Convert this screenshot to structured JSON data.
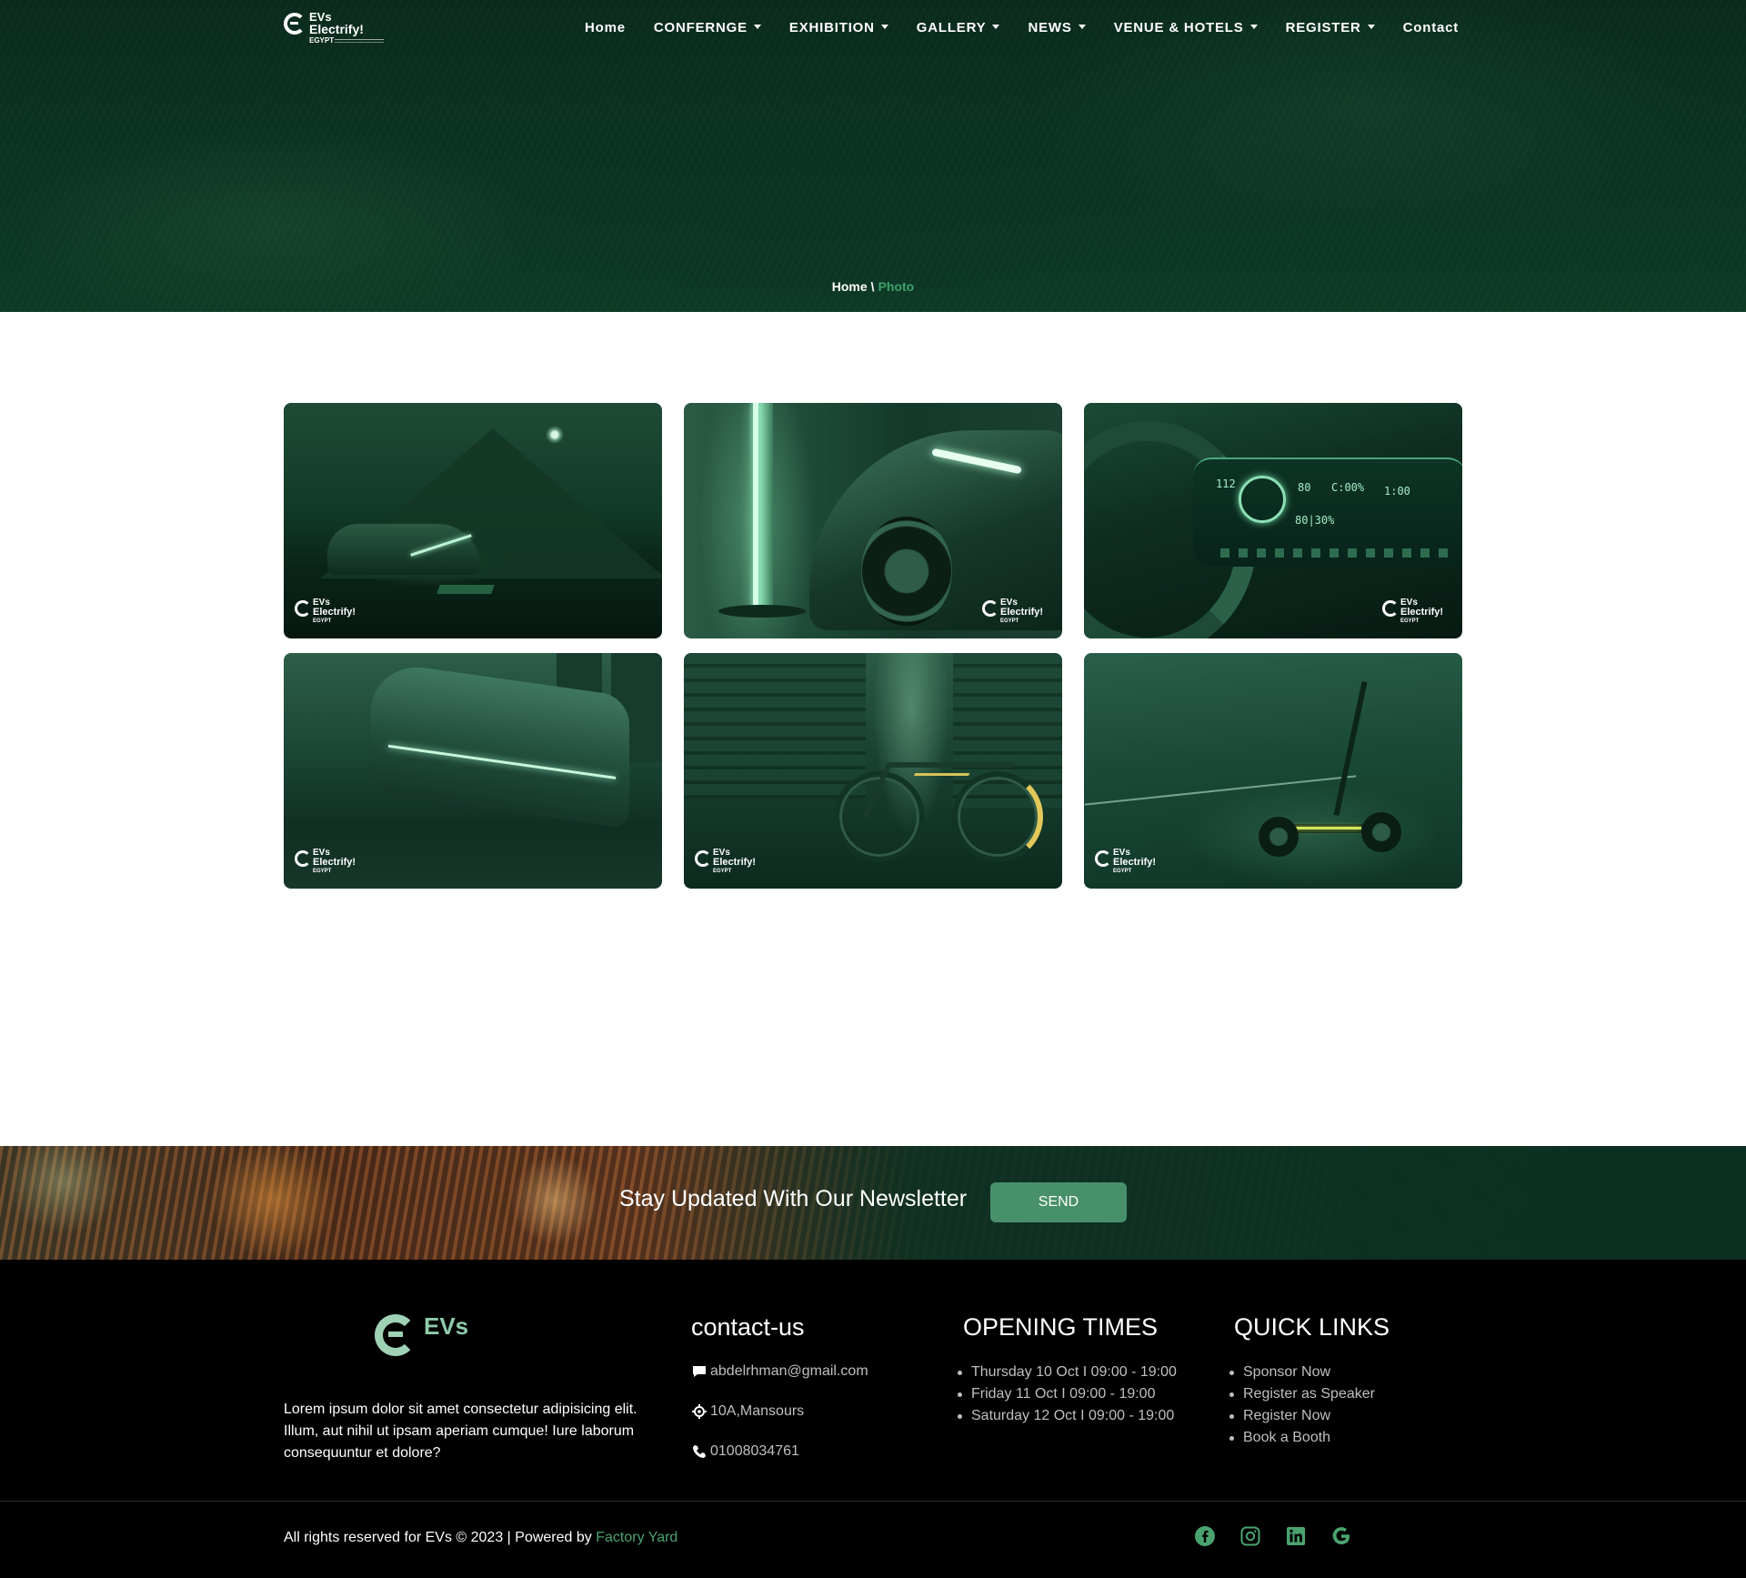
{
  "brand": {
    "logo_line1": "EVs",
    "logo_line2": "Electrify!",
    "logo_line3": "EGYPT",
    "watermark_line1": "EVs",
    "watermark_line2": "Electrify!",
    "watermark_line3": "EGYPT",
    "footer_logo_text": "EVs"
  },
  "nav": {
    "items": [
      {
        "label": "Home",
        "dropdown": false
      },
      {
        "label": "CONFERNGE",
        "dropdown": true
      },
      {
        "label": "EXHIBITION",
        "dropdown": true
      },
      {
        "label": "GALLERY",
        "dropdown": true
      },
      {
        "label": "NEWS",
        "dropdown": true
      },
      {
        "label": "VENUE & HOTELS",
        "dropdown": true
      },
      {
        "label": "REGISTER",
        "dropdown": true
      },
      {
        "label": "Contact",
        "dropdown": false
      }
    ]
  },
  "breadcrumb": {
    "home": "Home",
    "separator": "\\",
    "current": "Photo"
  },
  "gallery": {
    "photos": [
      {
        "subject": "electric car by pyramid"
      },
      {
        "subject": "electric car at charging station"
      },
      {
        "subject": "ev dashboard",
        "readouts": [
          "112",
          "80",
          "C:00%",
          "1:00",
          "80|30%"
        ]
      },
      {
        "subject": "electric bus"
      },
      {
        "subject": "electric bicycle"
      },
      {
        "subject": "electric scooter"
      }
    ]
  },
  "newsletter": {
    "title": "Stay Updated With Our Newsletter",
    "button_label": "SEND"
  },
  "footer": {
    "about": "Lorem ipsum dolor sit amet consectetur adipisicing elit. Illum, aut nihil ut ipsam aperiam cumque! Iure laborum consequuntur et dolore?",
    "contact_heading": "contact-us",
    "email": "abdelrhman@gmail.com",
    "address": "10A,Mansours",
    "phone": "01008034761",
    "opening_heading": "OPENING TIMES",
    "opening_times": [
      "Thursday 10 Oct I 09:00 - 19:00",
      "Friday 11 Oct I 09:00 - 19:00",
      "Saturday 12 Oct I 09:00 - 19:00"
    ],
    "links_heading": "QUICK LINKS",
    "quick_links": [
      "Sponsor Now",
      "Register as Speaker",
      "Register Now",
      "Book a Booth"
    ],
    "copyright": "All rights reserved for EVs © 2023 | Powered by ",
    "powered_by": "Factory Yard",
    "social": [
      "facebook-icon",
      "instagram-icon",
      "linkedin-icon",
      "google-icon"
    ]
  },
  "colors": {
    "accent_green": "#48906a",
    "link_green": "#4aa36f",
    "hero_dark": "#0b3322",
    "footer_bg": "#000000"
  }
}
